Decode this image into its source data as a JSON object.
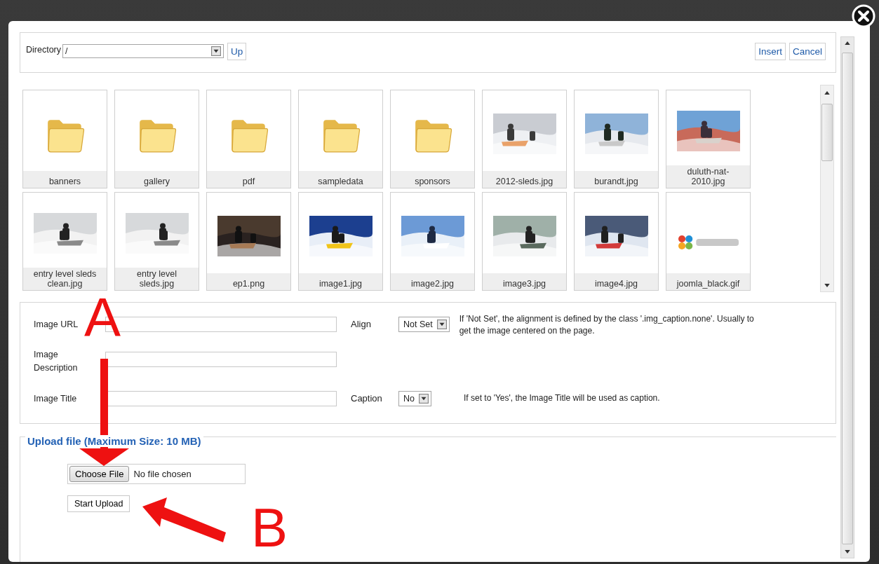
{
  "directory": {
    "label": "Directory",
    "value": "/",
    "up_button": "Up"
  },
  "actions": [
    "Insert",
    "Cancel"
  ],
  "files": [
    {
      "name": "banners",
      "kind": "folder"
    },
    {
      "name": "gallery",
      "kind": "folder"
    },
    {
      "name": "pdf",
      "kind": "folder"
    },
    {
      "name": "sampledata",
      "kind": "folder"
    },
    {
      "name": "sponsors",
      "kind": "folder"
    },
    {
      "name": "2012-sleds.jpg",
      "kind": "picture"
    },
    {
      "name": "burandt.jpg",
      "kind": "picture"
    },
    {
      "name": "duluth-nat-2010.jpg",
      "kind": "picture"
    },
    {
      "name": "entry level sleds clean.jpg",
      "kind": "picture"
    },
    {
      "name": "entry level sleds.jpg",
      "kind": "picture"
    },
    {
      "name": "ep1.png",
      "kind": "picture"
    },
    {
      "name": "image1.jpg",
      "kind": "picture"
    },
    {
      "name": "image2.jpg",
      "kind": "picture"
    },
    {
      "name": "image3.jpg",
      "kind": "picture"
    },
    {
      "name": "image4.jpg",
      "kind": "picture"
    },
    {
      "name": "joomla_black.gif",
      "kind": "picture"
    }
  ],
  "properties": [
    {
      "label": "Image URL",
      "option_label": "Align",
      "option_value": "Not Set",
      "help": "If 'Not Set', the alignment is defined by the class '.img_caption.none'. Usually to get the image centered on the page."
    },
    {
      "label": "Image Description"
    },
    {
      "label": "Image Title",
      "option_label": "Caption",
      "option_value": "No",
      "help": "If set to 'Yes', the Image Title will be used as caption."
    }
  ],
  "upload": {
    "legend": "Upload file (Maximum Size: 10 MB)",
    "choose_button": "Choose File",
    "file_status": "No file chosen",
    "start_button": "Start Upload"
  },
  "annotations": [
    {
      "label": "A"
    },
    {
      "label": "B"
    }
  ]
}
